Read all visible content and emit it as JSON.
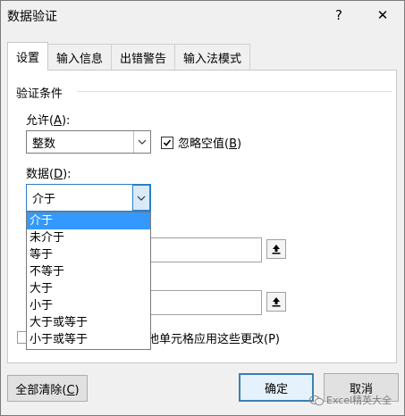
{
  "window": {
    "title": "数据验证",
    "help_symbol": "?",
    "close_symbol": "✕"
  },
  "tabs": [
    {
      "label": "设置",
      "active": true
    },
    {
      "label": "输入信息"
    },
    {
      "label": "出错警告"
    },
    {
      "label": "输入法模式"
    }
  ],
  "settings": {
    "group_title": "验证条件",
    "allow": {
      "label_prefix": "允许(",
      "label_key": "A",
      "label_suffix": "):",
      "value": "整数"
    },
    "ignore_blank": {
      "label_prefix": "忽略空值(",
      "label_key": "B",
      "label_suffix": ")",
      "checked": true
    },
    "data": {
      "label_prefix": "数据(",
      "label_key": "D",
      "label_suffix": "):",
      "value": "介于",
      "options": [
        "介于",
        "未介于",
        "等于",
        "不等于",
        "大于",
        "小于",
        "大于或等于",
        "小于或等于"
      ],
      "selected": "介于"
    },
    "apply_all_partial": "他单元格应用这些更改(P)",
    "ref_icon": "collapse-dialog-icon"
  },
  "buttons": {
    "clear_all_prefix": "全部清除(",
    "clear_all_key": "C",
    "clear_all_suffix": ")",
    "ok": "确定",
    "cancel_partial": "取消"
  },
  "watermark": {
    "text": "Excel精英大全",
    "icon": "wechat-icon"
  }
}
